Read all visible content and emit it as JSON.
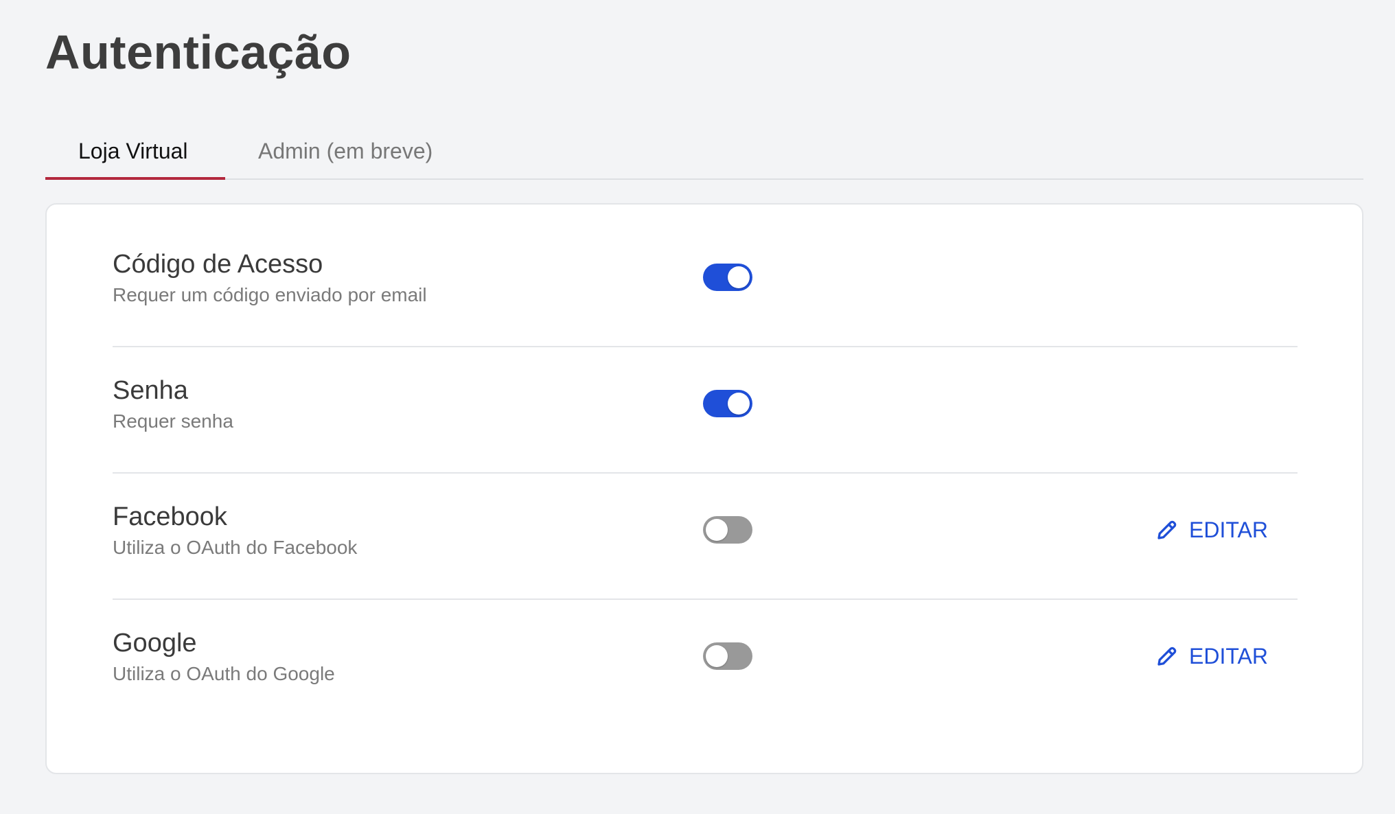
{
  "page": {
    "title": "Autenticação"
  },
  "tabs": [
    {
      "label": "Loja Virtual",
      "active": true
    },
    {
      "label": "Admin (em breve)",
      "active": false
    }
  ],
  "settings": [
    {
      "name": "Código de Acesso",
      "description": "Requer um código enviado por email",
      "enabled": true
    },
    {
      "name": "Senha",
      "description": "Requer senha",
      "enabled": true
    },
    {
      "name": "Facebook",
      "description": "Utiliza o OAuth do Facebook",
      "enabled": false,
      "edit_label": "EDITAR",
      "edit_icon": "pencil-icon"
    },
    {
      "name": "Google",
      "description": "Utiliza o OAuth do Google",
      "enabled": false,
      "edit_label": "EDITAR",
      "edit_icon": "pencil-icon"
    }
  ],
  "colors": {
    "accent": "#1f4fd8",
    "tab_indicator": "#b3283d",
    "toggle_off": "#999999",
    "background": "#f3f4f6"
  }
}
